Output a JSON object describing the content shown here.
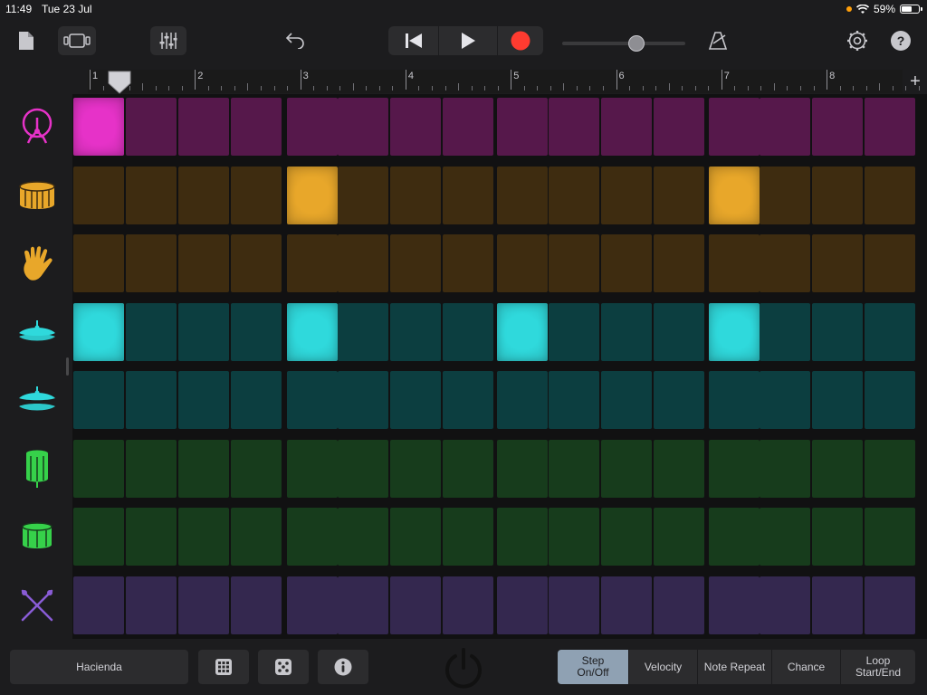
{
  "status": {
    "time": "11:49",
    "date": "Tue 23 Jul",
    "battery": "59%",
    "battery_level": 0.59
  },
  "toolbar": {
    "icons": [
      "document-icon",
      "tracks-view-icon",
      "mixer-icon",
      "undo-icon",
      "rewind-icon",
      "play-icon",
      "record-icon",
      "metronome-icon",
      "settings-icon",
      "help-icon"
    ],
    "volume_level": 0.6,
    "help_label": "?"
  },
  "ruler": {
    "bars": [
      "1",
      "2",
      "3",
      "4",
      "5",
      "6",
      "7",
      "8"
    ],
    "add_label": "+",
    "playhead_position": 1
  },
  "rows": [
    {
      "name": "kick",
      "icon": "kick-drum-icon",
      "on_color": "#e632c8",
      "off_color": "#56184b",
      "steps": [
        1,
        0,
        0,
        0,
        0,
        0,
        0,
        0,
        0,
        0,
        0,
        0,
        0,
        0,
        0,
        0
      ]
    },
    {
      "name": "snare",
      "icon": "snare-drum-icon",
      "on_color": "#e8a72a",
      "off_color": "#3e2c10",
      "steps": [
        0,
        0,
        0,
        0,
        1,
        0,
        0,
        0,
        0,
        0,
        0,
        0,
        1,
        0,
        0,
        0
      ]
    },
    {
      "name": "clap",
      "icon": "clap-hand-icon",
      "on_color": "#e8a72a",
      "off_color": "#3e2c10",
      "steps": [
        0,
        0,
        0,
        0,
        0,
        0,
        0,
        0,
        0,
        0,
        0,
        0,
        0,
        0,
        0,
        0
      ]
    },
    {
      "name": "hihat-closed",
      "icon": "hihat-closed-icon",
      "on_color": "#2fd9dc",
      "off_color": "#0c3e40",
      "steps": [
        1,
        0,
        0,
        0,
        1,
        0,
        0,
        0,
        1,
        0,
        0,
        0,
        1,
        0,
        0,
        0
      ]
    },
    {
      "name": "hihat-open",
      "icon": "hihat-open-icon",
      "on_color": "#2fd9dc",
      "off_color": "#0c3e40",
      "steps": [
        0,
        0,
        0,
        0,
        0,
        0,
        0,
        0,
        0,
        0,
        0,
        0,
        0,
        0,
        0,
        0
      ]
    },
    {
      "name": "tom-high",
      "icon": "tom-high-icon",
      "on_color": "#36d14a",
      "off_color": "#173c1c",
      "steps": [
        0,
        0,
        0,
        0,
        0,
        0,
        0,
        0,
        0,
        0,
        0,
        0,
        0,
        0,
        0,
        0
      ]
    },
    {
      "name": "tom-low",
      "icon": "tom-low-icon",
      "on_color": "#36d14a",
      "off_color": "#173c1c",
      "steps": [
        0,
        0,
        0,
        0,
        0,
        0,
        0,
        0,
        0,
        0,
        0,
        0,
        0,
        0,
        0,
        0
      ]
    },
    {
      "name": "sticks",
      "icon": "crossed-sticks-icon",
      "on_color": "#8a5cd6",
      "off_color": "#34284f",
      "steps": [
        0,
        0,
        0,
        0,
        0,
        0,
        0,
        0,
        0,
        0,
        0,
        0,
        0,
        0,
        0,
        0
      ]
    }
  ],
  "bottom": {
    "pattern_name": "Hacienda",
    "icons": [
      "grid-icon",
      "dice-icon",
      "info-icon",
      "power-icon"
    ],
    "modes": [
      {
        "label": "Step On/Off",
        "active": true
      },
      {
        "label": "Velocity",
        "active": false
      },
      {
        "label": "Note Repeat",
        "active": false
      },
      {
        "label": "Chance",
        "active": false
      },
      {
        "label": "Loop Start/End",
        "active": false
      }
    ]
  }
}
